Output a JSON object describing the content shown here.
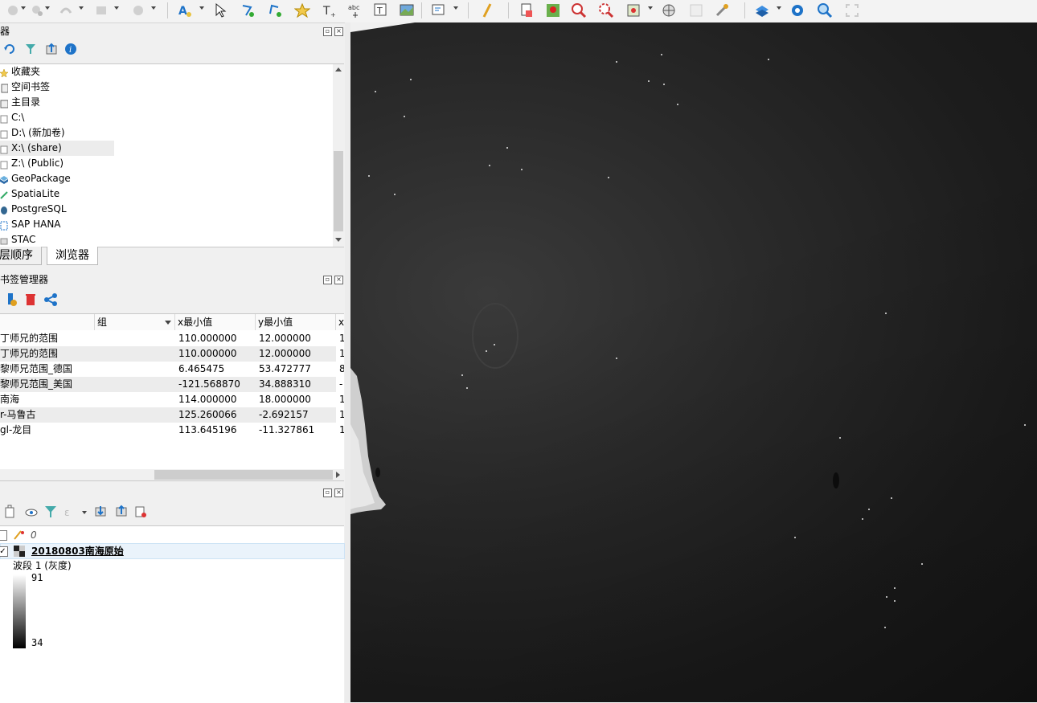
{
  "colors": {
    "map_bg": "#1c1c1c",
    "accent_blue": "#1e73c8"
  },
  "toolbar": {
    "icons": [
      "add-layer-group-icon",
      "add-polygon-icon",
      "add-line-icon",
      "add-rect-icon",
      "add-circle-icon",
      "label-icon",
      "select-icon",
      "node-tool-icon",
      "vertex-tool-icon",
      "favorite-icon",
      "text-icon",
      "move-label-icon",
      "text-annotation-icon",
      "image-annotation-icon",
      "script-icon",
      "pen-icon",
      "duplicate-icon",
      "pin-icon",
      "zoom-in-icon",
      "zoom-full-icon",
      "select-feature-icon",
      "globe-icon",
      "snapping-icon",
      "tools-icon",
      "layers-icon",
      "settings-icon",
      "search-icon",
      "fullscreen-icon"
    ]
  },
  "browser_panel": {
    "title": "器",
    "items": [
      {
        "label": "收藏夹",
        "icon": "star-icon"
      },
      {
        "label": "空间书签",
        "icon": "bookmark-icon"
      },
      {
        "label": "主目录",
        "icon": "home-folder-icon"
      },
      {
        "label": "C:\\",
        "icon": "drive-icon"
      },
      {
        "label": "D:\\ (新加卷)",
        "icon": "drive-icon"
      },
      {
        "label": "X:\\ (share)",
        "icon": "drive-icon"
      },
      {
        "label": "Z:\\ (Public)",
        "icon": "drive-icon"
      },
      {
        "label": "GeoPackage",
        "icon": "geopackage-icon"
      },
      {
        "label": "SpatiaLite",
        "icon": "spatialite-icon"
      },
      {
        "label": "PostgreSQL",
        "icon": "postgresql-icon"
      },
      {
        "label": "SAP HANA",
        "icon": "saphana-icon"
      },
      {
        "label": "STAC",
        "icon": "stac-icon"
      }
    ]
  },
  "tabs": [
    {
      "label": "层顺序"
    },
    {
      "label": "浏览器"
    }
  ],
  "bookmarks_panel": {
    "title": "书签管理器",
    "columns": [
      "组",
      "x最小值",
      "y最小值",
      "x"
    ],
    "rows": [
      {
        "name": "丁师兄的范围",
        "xmin": "110.000000",
        "ymin": "12.000000",
        "x": "1"
      },
      {
        "name": "丁师兄的范围",
        "xmin": "110.000000",
        "ymin": "12.000000",
        "x": "1"
      },
      {
        "name": "黎师兄范围_德国",
        "xmin": "6.465475",
        "ymin": "53.472777",
        "x": "8"
      },
      {
        "name": "黎师兄范围_美国",
        "xmin": "-121.568870",
        "ymin": "34.888310",
        "x": "-"
      },
      {
        "name": "南海",
        "xmin": "114.000000",
        "ymin": "18.000000",
        "x": "1"
      },
      {
        "name": "r-马鲁古",
        "xmin": "125.260066",
        "ymin": "-2.692157",
        "x": "1"
      },
      {
        "name": "gl-龙目",
        "xmin": "113.645196",
        "ymin": "-11.327861",
        "x": "1"
      }
    ]
  },
  "layers_panel": {
    "layers": [
      {
        "name": "0",
        "checked": false
      },
      {
        "name": "20180803南海原始",
        "checked": true
      }
    ],
    "band_label": "波段 1 (灰度)",
    "legend_max": "91",
    "legend_min": "34"
  }
}
